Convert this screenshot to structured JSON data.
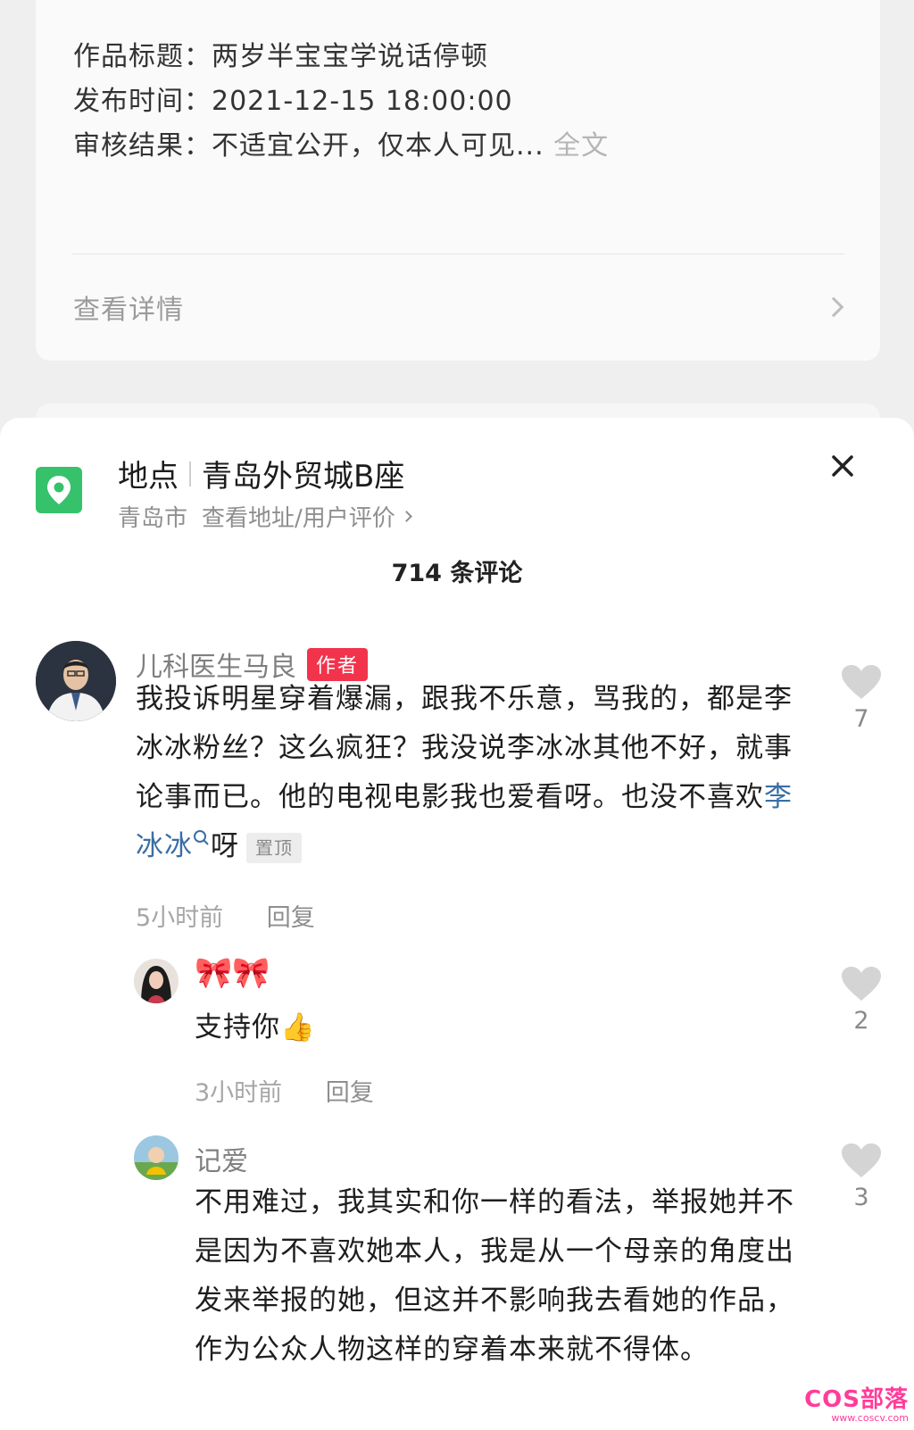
{
  "review": {
    "title_line": "作品标题：两岁半宝宝学说话停顿",
    "time_line": "发布时间：2021-12-15 18:00:00",
    "result_line": "审核结果：不适宜公开，仅本人可见...",
    "full_text_link": "全文",
    "view_details": "查看详情"
  },
  "location": {
    "label": "地点",
    "name": "青岛外贸城B座",
    "city": "青岛市",
    "link": "查看地址/用户评价",
    "icon": "location-pin-icon",
    "accent": "#35c26b"
  },
  "comments_header": {
    "count_text": "714 条评论"
  },
  "comments": [
    {
      "user": "儿科医生马良",
      "badge": "作者",
      "text_part1": "我投诉明星穿着爆漏，跟我不乐意，骂我的，都是李冰冰粉丝？这么疯狂？我没说李冰冰其他不好，就事论事而已。他的电视电影我也爱看呀。也没不喜欢",
      "link_text": "李冰冰",
      "text_part2": "呀",
      "pin": "置顶",
      "time": "5小时前",
      "reply": "回复",
      "likes": "7"
    },
    {
      "user": "🎀🎀",
      "text": "支持你👍",
      "time": "3小时前",
      "reply": "回复",
      "likes": "2"
    },
    {
      "user": "记爱",
      "text": "不用难过，我其实和你一样的看法，举报她并不是因为不喜欢她本人，我是从一个母亲的角度出发来举报的她，但这并不影响我去看她的作品，作为公众人物这样的穿着本来就不得体。",
      "likes": "3"
    }
  ],
  "watermark": {
    "main": "COS部落",
    "sub": "www.coscv.com"
  },
  "colors": {
    "author_badge": "#f2334c",
    "link": "#3a6ea5",
    "watermark": "#ff3d9a"
  }
}
